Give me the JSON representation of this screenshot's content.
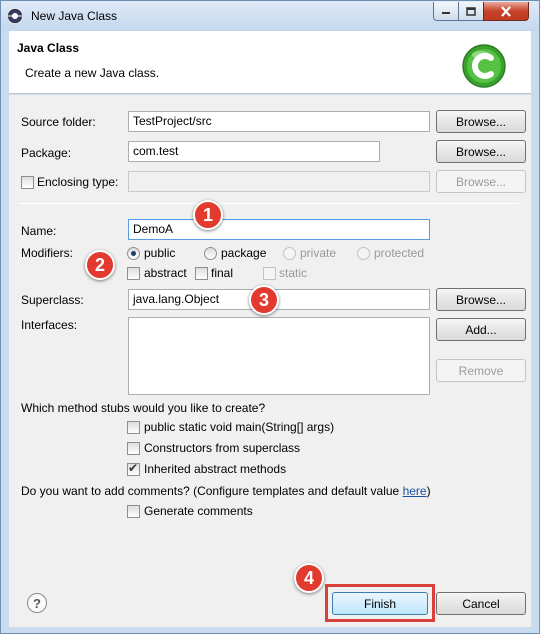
{
  "window": {
    "title": "New Java Class",
    "controls": {
      "minimize": "minimize-icon",
      "maximize": "maximize-icon",
      "close": "close-icon"
    }
  },
  "header": {
    "title": "Java Class",
    "subtitle": "Create a new Java class.",
    "logo_icon": "java-class-logo-icon"
  },
  "form": {
    "source_folder": {
      "label": "Source folder:",
      "value": "TestProject/src",
      "button": "Browse..."
    },
    "package": {
      "label": "Package:",
      "value": "com.test",
      "button": "Browse..."
    },
    "enclosing_type": {
      "label": "Enclosing type:",
      "value": "",
      "checked": false,
      "button": "Browse..."
    },
    "name": {
      "label": "Name:",
      "value": "DemoA"
    },
    "modifiers": {
      "label": "Modifiers:",
      "access": [
        {
          "label": "public",
          "selected": true,
          "enabled": true
        },
        {
          "label": "package",
          "selected": false,
          "enabled": true
        },
        {
          "label": "private",
          "selected": false,
          "enabled": false
        },
        {
          "label": "protected",
          "selected": false,
          "enabled": false
        }
      ],
      "other": [
        {
          "label": "abstract",
          "checked": false,
          "enabled": true
        },
        {
          "label": "final",
          "checked": false,
          "enabled": true
        },
        {
          "label": "static",
          "checked": false,
          "enabled": false
        }
      ]
    },
    "superclass": {
      "label": "Superclass:",
      "value": "java.lang.Object",
      "button": "Browse..."
    },
    "interfaces": {
      "label": "Interfaces:",
      "add_button": "Add...",
      "remove_button": "Remove"
    },
    "stubs": {
      "question": "Which method stubs would you like to create?",
      "options": [
        {
          "label": "public static void main(String[] args)",
          "checked": false
        },
        {
          "label": "Constructors from superclass",
          "checked": false
        },
        {
          "label": "Inherited abstract methods",
          "checked": true
        }
      ]
    },
    "comments": {
      "question": "Do you want to add comments? (Configure templates and default value ",
      "link": "here",
      "question_end": ")",
      "option": {
        "label": "Generate comments",
        "checked": false
      }
    }
  },
  "footer": {
    "help_icon": "help-icon",
    "help_text": "?",
    "finish": "Finish",
    "cancel": "Cancel"
  },
  "annotations": [
    "1",
    "2",
    "3",
    "4"
  ],
  "colors": {
    "badge": "#e23a2f",
    "highlight": "#d9403a",
    "link": "#1d4fa8"
  }
}
